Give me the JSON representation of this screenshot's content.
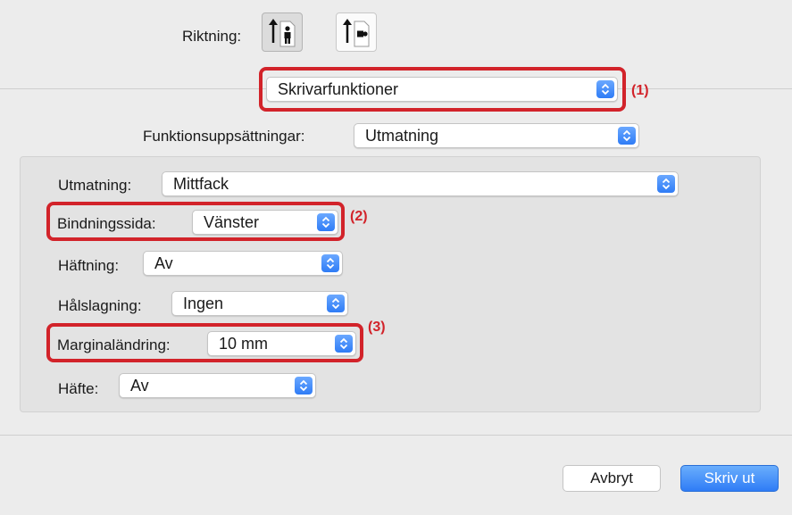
{
  "orientation": {
    "label": "Riktning:",
    "options": [
      "portrait-icon",
      "landscape-icon"
    ],
    "selected": "portrait-icon"
  },
  "panel_menu": {
    "value": "Skrivarfunktioner"
  },
  "feature_sets": {
    "label": "Funktionsuppsättningar:",
    "value": "Utmatning"
  },
  "settings": {
    "output": {
      "label": "Utmatning:",
      "value": "Mittfack"
    },
    "binding": {
      "label": "Bindningssida:",
      "value": "Vänster"
    },
    "stapling": {
      "label": "Häftning:",
      "value": "Av"
    },
    "punch": {
      "label": "Hålslagning:",
      "value": "Ingen"
    },
    "margin": {
      "label": "Marginaländring:",
      "value": "10 mm"
    },
    "booklet": {
      "label": "Häfte:",
      "value": "Av"
    }
  },
  "annotations": {
    "a1": "(1)",
    "a2": "(2)",
    "a3": "(3)"
  },
  "buttons": {
    "cancel": "Avbryt",
    "print": "Skriv ut"
  },
  "colors": {
    "accent": "#2f7cf6",
    "highlight": "#d2232a"
  }
}
